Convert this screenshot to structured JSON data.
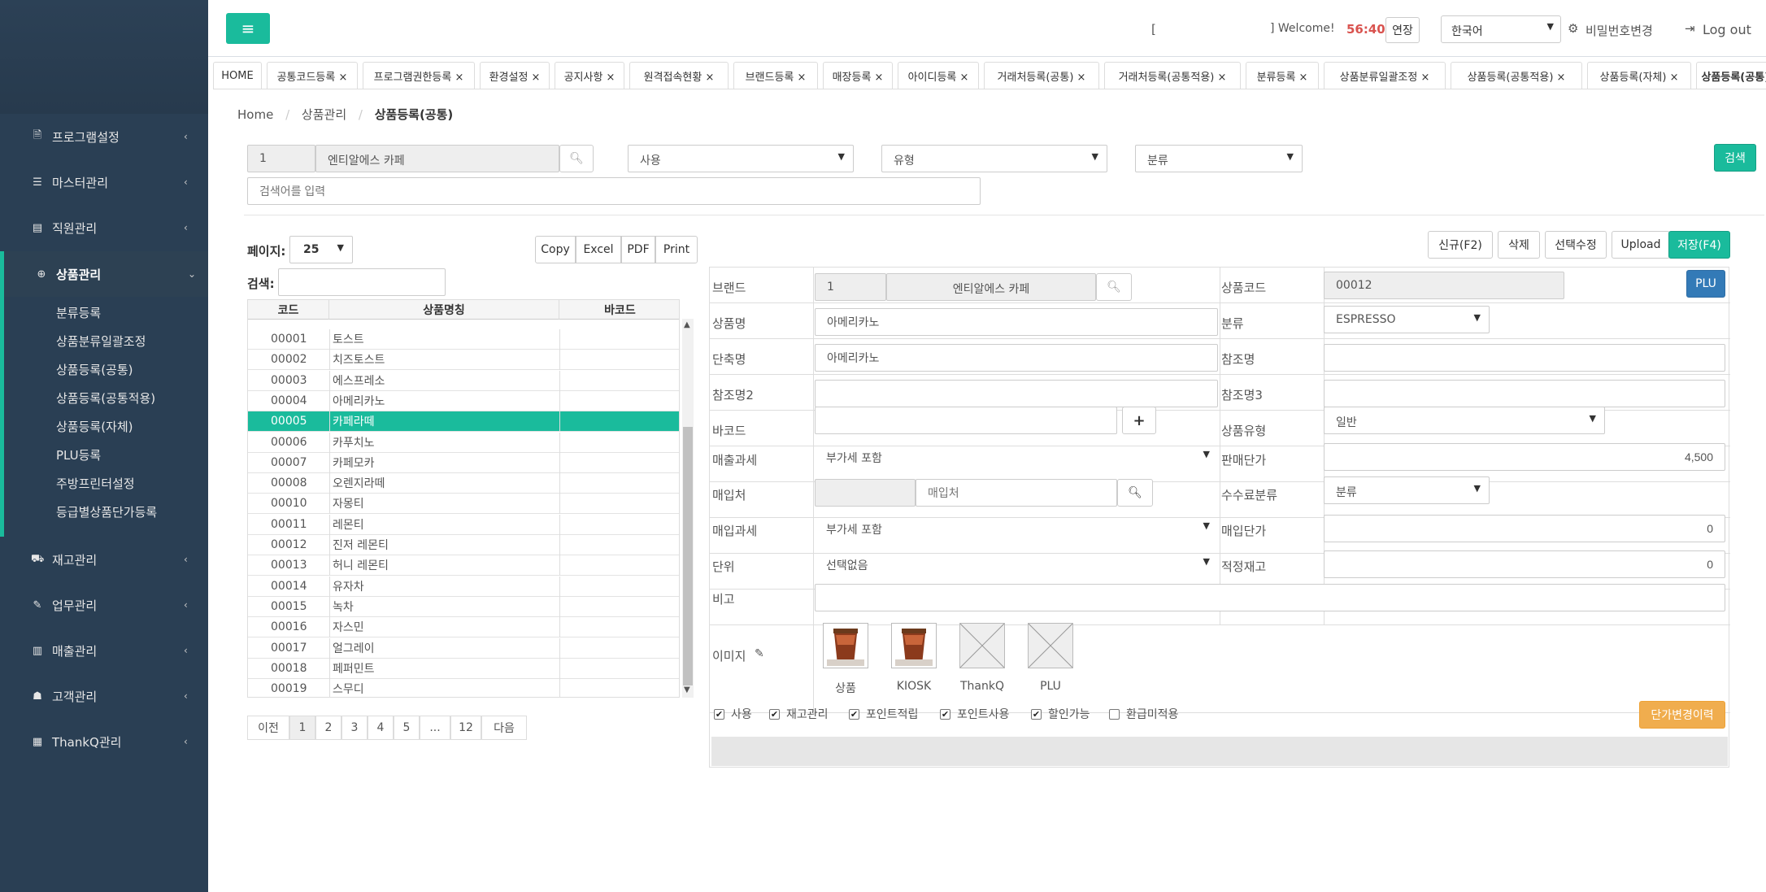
{
  "sidebar": {
    "menu": [
      {
        "icon": "document-icon",
        "glyph": "🗎",
        "label": "프로그램설정"
      },
      {
        "icon": "list-icon",
        "glyph": "☰",
        "label": "마스터관리"
      },
      {
        "icon": "id-card-icon",
        "glyph": "▤",
        "label": "직원관리"
      },
      {
        "icon": "globe-icon",
        "glyph": "⊕",
        "label": "상품관리"
      },
      {
        "icon": "cart-icon",
        "glyph": "⛟",
        "label": "재고관리"
      },
      {
        "icon": "pencil-icon",
        "glyph": "✎",
        "label": "업무관리"
      },
      {
        "icon": "bar-chart-icon",
        "glyph": "▥",
        "label": "매출관리"
      },
      {
        "icon": "users-icon",
        "glyph": "☗",
        "label": "고객관리"
      },
      {
        "icon": "grid-icon",
        "glyph": "▦",
        "label": "ThankQ관리"
      }
    ],
    "submenu": [
      "분류등록",
      "상품분류일괄조정",
      "상품등록(공통)",
      "상품등록(공통적용)",
      "상품등록(자체)",
      "PLU등록",
      "주방프린터설정",
      "등급별상품단가등록"
    ]
  },
  "topbar": {
    "bracket_open": "[",
    "welcome": "] Welcome!",
    "timer": "56:40",
    "extend_label": "연장",
    "language": "한국어",
    "change_password": "비밀번호변경",
    "logout": "Log out",
    "menu_glyph": "≡"
  },
  "tabs": [
    "HOME",
    "공통코드등록 ×",
    "프로그램권한등록 ×",
    "환경설정 ×",
    "공지사항 ×",
    "원격접속현황 ×",
    "브랜드등록 ×",
    "매장등록 ×",
    "아이디등록 ×",
    "거래처등록(공통) ×",
    "거래처등록(공통적용) ×",
    "분류등록 ×",
    "상품분류일괄조정 ×",
    "상품등록(공통적용) ×",
    "상품등록(자체) ×",
    "상품등록(공통) ×"
  ],
  "breadcrumb": {
    "home": "Home",
    "sep": "/",
    "section": "상품관리",
    "current": "상품등록(공통)"
  },
  "search": {
    "brand_code": "1",
    "brand_name": "엔티알에스 카페",
    "use_select": "사용",
    "type_select": "유형",
    "category_select": "분류",
    "keyword_placeholder": "검색어를 입력",
    "search_button": "검색"
  },
  "list": {
    "page_size_label": "페이지:",
    "page_size": "25",
    "export_buttons": [
      "Copy",
      "Excel",
      "PDF",
      "Print"
    ],
    "filter_label": "검색:",
    "columns": [
      "코드",
      "상품명칭",
      "바코드"
    ],
    "rows": [
      {
        "code": "00001",
        "name": "토스트"
      },
      {
        "code": "00002",
        "name": "치즈토스트"
      },
      {
        "code": "00003",
        "name": "에스프레소"
      },
      {
        "code": "00004",
        "name": "아메리카노"
      },
      {
        "code": "00005",
        "name": "카페라떼"
      },
      {
        "code": "00006",
        "name": "카푸치노"
      },
      {
        "code": "00007",
        "name": "카페모카"
      },
      {
        "code": "00008",
        "name": "오렌지라떼"
      },
      {
        "code": "00010",
        "name": "자몽티"
      },
      {
        "code": "00011",
        "name": "레몬티"
      },
      {
        "code": "00012",
        "name": "진저 레몬티"
      },
      {
        "code": "00013",
        "name": "허니 레몬티"
      },
      {
        "code": "00014",
        "name": "유자차"
      },
      {
        "code": "00015",
        "name": "녹차"
      },
      {
        "code": "00016",
        "name": "자스민"
      },
      {
        "code": "00017",
        "name": "얼그레이"
      },
      {
        "code": "00018",
        "name": "페퍼민트"
      },
      {
        "code": "00019",
        "name": "스무디"
      }
    ],
    "selected_index": 4,
    "pagination": [
      "이전",
      "1",
      "2",
      "3",
      "4",
      "5",
      "...",
      "12",
      "다음"
    ]
  },
  "actions": {
    "new": "신규(F2)",
    "delete": "삭제",
    "edit_selected": "선택수정",
    "upload": "Upload",
    "save": "저장(F4)"
  },
  "form": {
    "brand_label": "브랜드",
    "brand_code": "1",
    "brand_name": "엔티알에스 카페",
    "product_code_label": "상품코드",
    "product_code": "00012",
    "plu_button": "PLU",
    "product_name_label": "상품명",
    "product_name": "아메리카노",
    "category_label": "분류",
    "category": "ESPRESSO",
    "short_name_label": "단축명",
    "short_name": "아메리카노",
    "ref_name_label": "참조명",
    "ref_name": "",
    "ref_name2_label": "참조명2",
    "ref_name2": "",
    "ref_name3_label": "참조명3",
    "ref_name3": "",
    "barcode_label": "바코드",
    "barcode": "",
    "add_glyph": "+",
    "product_type_label": "상품유형",
    "product_type": "일반",
    "sales_tax_label": "매출과세",
    "sales_tax": "부가세 포함",
    "sale_price_label": "판매단가",
    "sale_price": "4,500",
    "supplier_label": "매입처",
    "supplier_placeholder": "매입처",
    "fee_category_label": "수수료분류",
    "fee_category": "분류",
    "purchase_tax_label": "매입과세",
    "purchase_tax": "부가세 포함",
    "purchase_price_label": "매입단가",
    "purchase_price": "0",
    "unit_label": "단위",
    "unit": "선택없음",
    "proper_stock_label": "적정재고",
    "proper_stock": "0",
    "note_label": "비고",
    "note": "",
    "image_label": "이미지",
    "images": [
      "상품",
      "KIOSK",
      "ThankQ",
      "PLU"
    ],
    "checkboxes": [
      {
        "label": "사용",
        "checked": true
      },
      {
        "label": "재고관리",
        "checked": true
      },
      {
        "label": "포인트적립",
        "checked": true
      },
      {
        "label": "포인트사용",
        "checked": true
      },
      {
        "label": "할인가능",
        "checked": true
      },
      {
        "label": "환급미적용",
        "checked": false
      }
    ],
    "price_history_button": "단가변경이력"
  },
  "colors": {
    "sidebar": "#2a3f54",
    "accent": "#1abb9c",
    "blue": "#337ab7",
    "orange": "#f0ad4e",
    "timer": "#d9534f"
  }
}
